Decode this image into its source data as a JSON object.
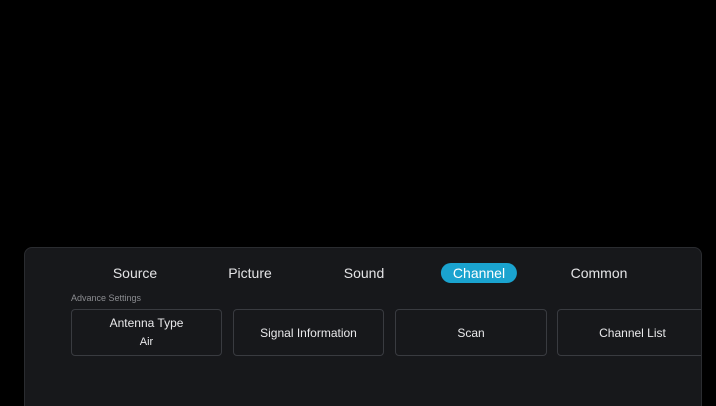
{
  "menu": {
    "tabs": [
      {
        "label": "Source"
      },
      {
        "label": "Picture"
      },
      {
        "label": "Sound"
      },
      {
        "label": "Channel",
        "active": true
      },
      {
        "label": "Common"
      }
    ],
    "active_tab": "Channel",
    "accent_color": "#1aa3cf"
  },
  "advance_settings": {
    "section_label": "Advance Settings",
    "cards": [
      {
        "title": "Antenna Type",
        "value": "Air"
      },
      {
        "title": "Signal Information"
      },
      {
        "title": "Scan"
      },
      {
        "title": "Channel List"
      }
    ]
  }
}
